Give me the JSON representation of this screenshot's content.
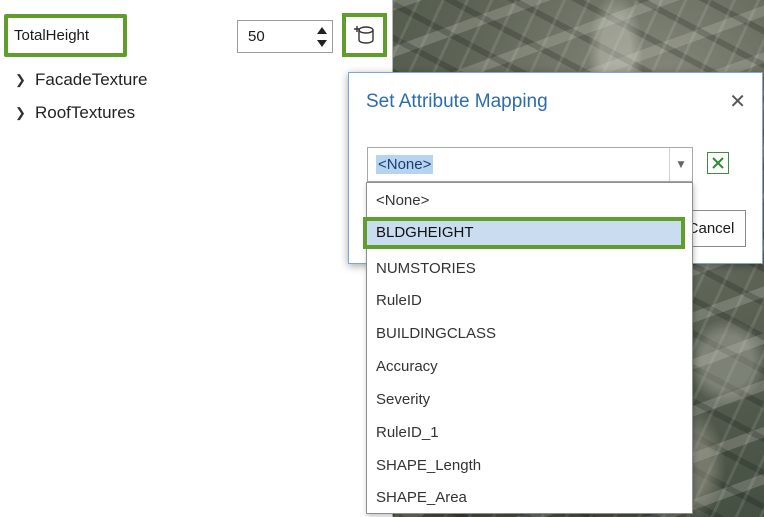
{
  "attribute": {
    "name": "TotalHeight",
    "value": "50"
  },
  "tree": {
    "items": [
      "FacadeTexture",
      "RoofTextures"
    ]
  },
  "dialog": {
    "title": "Set Attribute Mapping",
    "close_symbol": "✕",
    "combo_value": "<None>",
    "cancel_label": "Cancel"
  },
  "dropdown": {
    "options": [
      "<None>",
      "BLDGHEIGHT",
      "NUMSTORIES",
      "RuleID",
      "BUILDINGCLASS",
      "Accuracy",
      "Severity",
      "RuleID_1",
      "SHAPE_Length",
      "SHAPE_Area"
    ],
    "selected": "BLDGHEIGHT"
  },
  "colors": {
    "highlight_border": "#5f9e2d",
    "title_blue": "#2b6cb0",
    "selected_bg": "#c9dcf0"
  },
  "icons": {
    "map_attribute": "database-plus-icon",
    "clear": "clear-x-icon",
    "spinner": "up-down-spinner-icon"
  }
}
